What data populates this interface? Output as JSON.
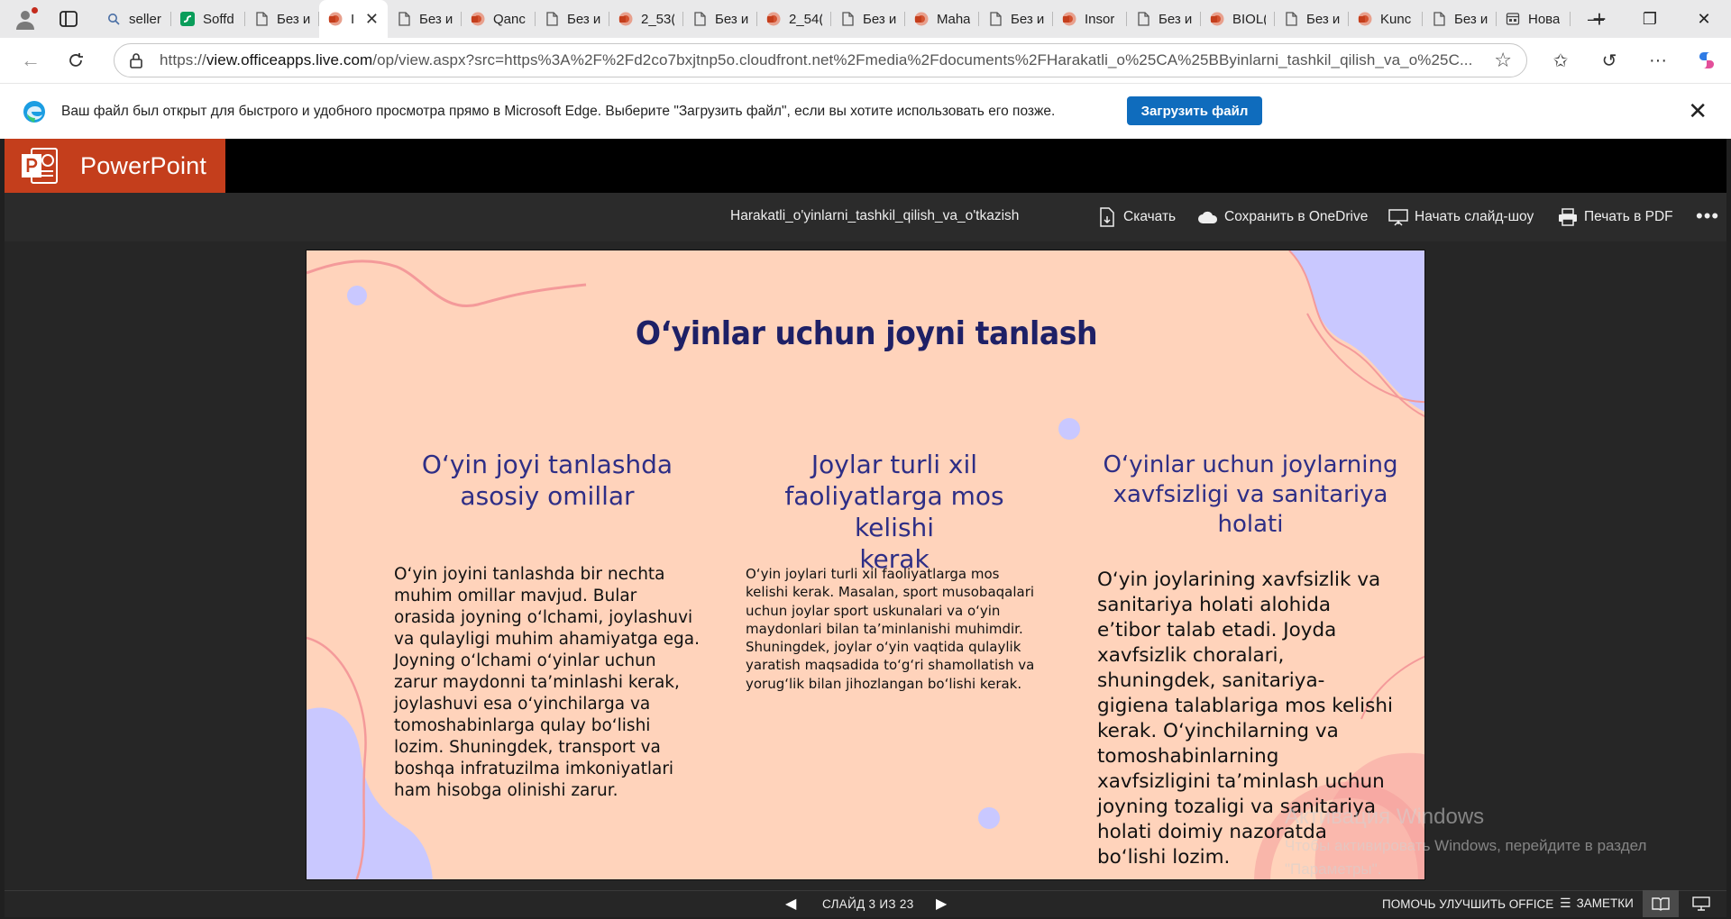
{
  "browser": {
    "tabs": [
      {
        "label": "seller",
        "icon": "search-icon"
      },
      {
        "label": "Soffd",
        "icon": "soffd-site-icon"
      },
      {
        "label": "Без и",
        "icon": "document-icon"
      },
      {
        "label": "I",
        "icon": "powerpoint-icon",
        "active": true
      },
      {
        "label": "Без и",
        "icon": "document-icon"
      },
      {
        "label": "Qanc",
        "icon": "powerpoint-icon"
      },
      {
        "label": "Без и",
        "icon": "document-icon"
      },
      {
        "label": "2_53(",
        "icon": "powerpoint-icon"
      },
      {
        "label": "Без и",
        "icon": "document-icon"
      },
      {
        "label": "2_54(",
        "icon": "powerpoint-icon"
      },
      {
        "label": "Без и",
        "icon": "document-icon"
      },
      {
        "label": "Maha",
        "icon": "powerpoint-icon"
      },
      {
        "label": "Без и",
        "icon": "document-icon"
      },
      {
        "label": "Insor",
        "icon": "powerpoint-icon"
      },
      {
        "label": "Без и",
        "icon": "document-icon"
      },
      {
        "label": "BIOL(",
        "icon": "powerpoint-icon"
      },
      {
        "label": "Без и",
        "icon": "document-icon"
      },
      {
        "label": "Kunc",
        "icon": "powerpoint-icon"
      },
      {
        "label": "Без и",
        "icon": "document-icon"
      },
      {
        "label": "Нова",
        "icon": "new-tab-icon"
      }
    ],
    "url_prefix": "https://",
    "url_host": "view.officeapps.live.com",
    "url_rest": "/op/view.aspx?src=https%3A%2F%2Fd2co7bxjtnp5o.cloudfront.net%2Fmedia%2Fdocuments%2FHarakatli_o%25CA%25BByinlarni_tashkil_qilish_va_o%25C..."
  },
  "infobar": {
    "message": "Ваш файл был открыт для быстрого и удобного просмотра прямо в Microsoft Edge. Выберите \"Загрузить файл\", если вы хотите использовать его позже.",
    "download_label": "Загрузить файл"
  },
  "office": {
    "app_name": "PowerPoint",
    "brand_color": "#c43e1c",
    "doc_name": "Harakatli_o'yinlarni_tashkil_qilish_va_o'tkazish",
    "commands": {
      "download": "Скачать",
      "onedrive": "Сохранить в OneDrive",
      "slideshow": "Начать слайд-шоу",
      "print": "Печать в PDF"
    }
  },
  "slide": {
    "background": "#ffd3bb",
    "title": "O‘yinlar uchun joyni tanlash",
    "columns": [
      {
        "heading_lines": [
          "O‘yin joyi tanlashda",
          "asosiy omillar"
        ],
        "body": "O‘yin joyini tanlashda bir nechta muhim omillar mavjud. Bular orasida joyning o‘lchami, joylashuvi va qulayligi muhim ahamiyatga ega. Joyning o‘lchami o‘yinlar uchun zarur maydonni ta’minlashi kerak, joylashuvi esa o‘yinchilarga va tomoshabinlarga qulay bo‘lishi lozim. Shuningdek, transport va boshqa infratuzilma imkoniyatlari ham hisobga olinishi zarur."
      },
      {
        "heading_lines": [
          "Joylar turli xil",
          "faoliyatlarga mos kelishi",
          "kerak"
        ],
        "body": "O‘yin joylari turli xil faoliyatlarga mos kelishi kerak. Masalan, sport musobaqalari uchun joylar sport uskunalari va o‘yin maydonlari bilan ta’minlanishi muhimdir. Shuningdek, joylar o‘yin vaqtida qulaylik yaratish maqsadida to‘g‘ri shamollatish va yorug‘lik bilan jihozlangan bo‘lishi kerak."
      },
      {
        "heading_lines": [
          "O‘yinlar uchun joylarning",
          "xavfsizligi va sanitariya",
          "holati"
        ],
        "body": "O‘yin joylarining xavfsizlik va sanitariya holati alohida e’tibor talab etadi. Joyda xavfsizlik choralari, shuningdek, sanitariya-gigiena talablariga mos kelishi kerak. O‘yinchilarning va tomoshabinlarning xavfsizligini ta’minlash uchun joyning tozaligi va sanitariya holati doimiy nazoratda bo‘lishi lozim."
      }
    ]
  },
  "watermark": {
    "line1": "Активация Windows",
    "line2": "Чтобы активировать Windows, перейдите в раздел",
    "line3": "\"Параметры\"."
  },
  "statusbar": {
    "slide_counter": "СЛАЙД 3 ИЗ 23",
    "improve": "ПОМОЧЬ УЛУЧШИТЬ OFFICE",
    "notes": "ЗАМЕТКИ"
  }
}
